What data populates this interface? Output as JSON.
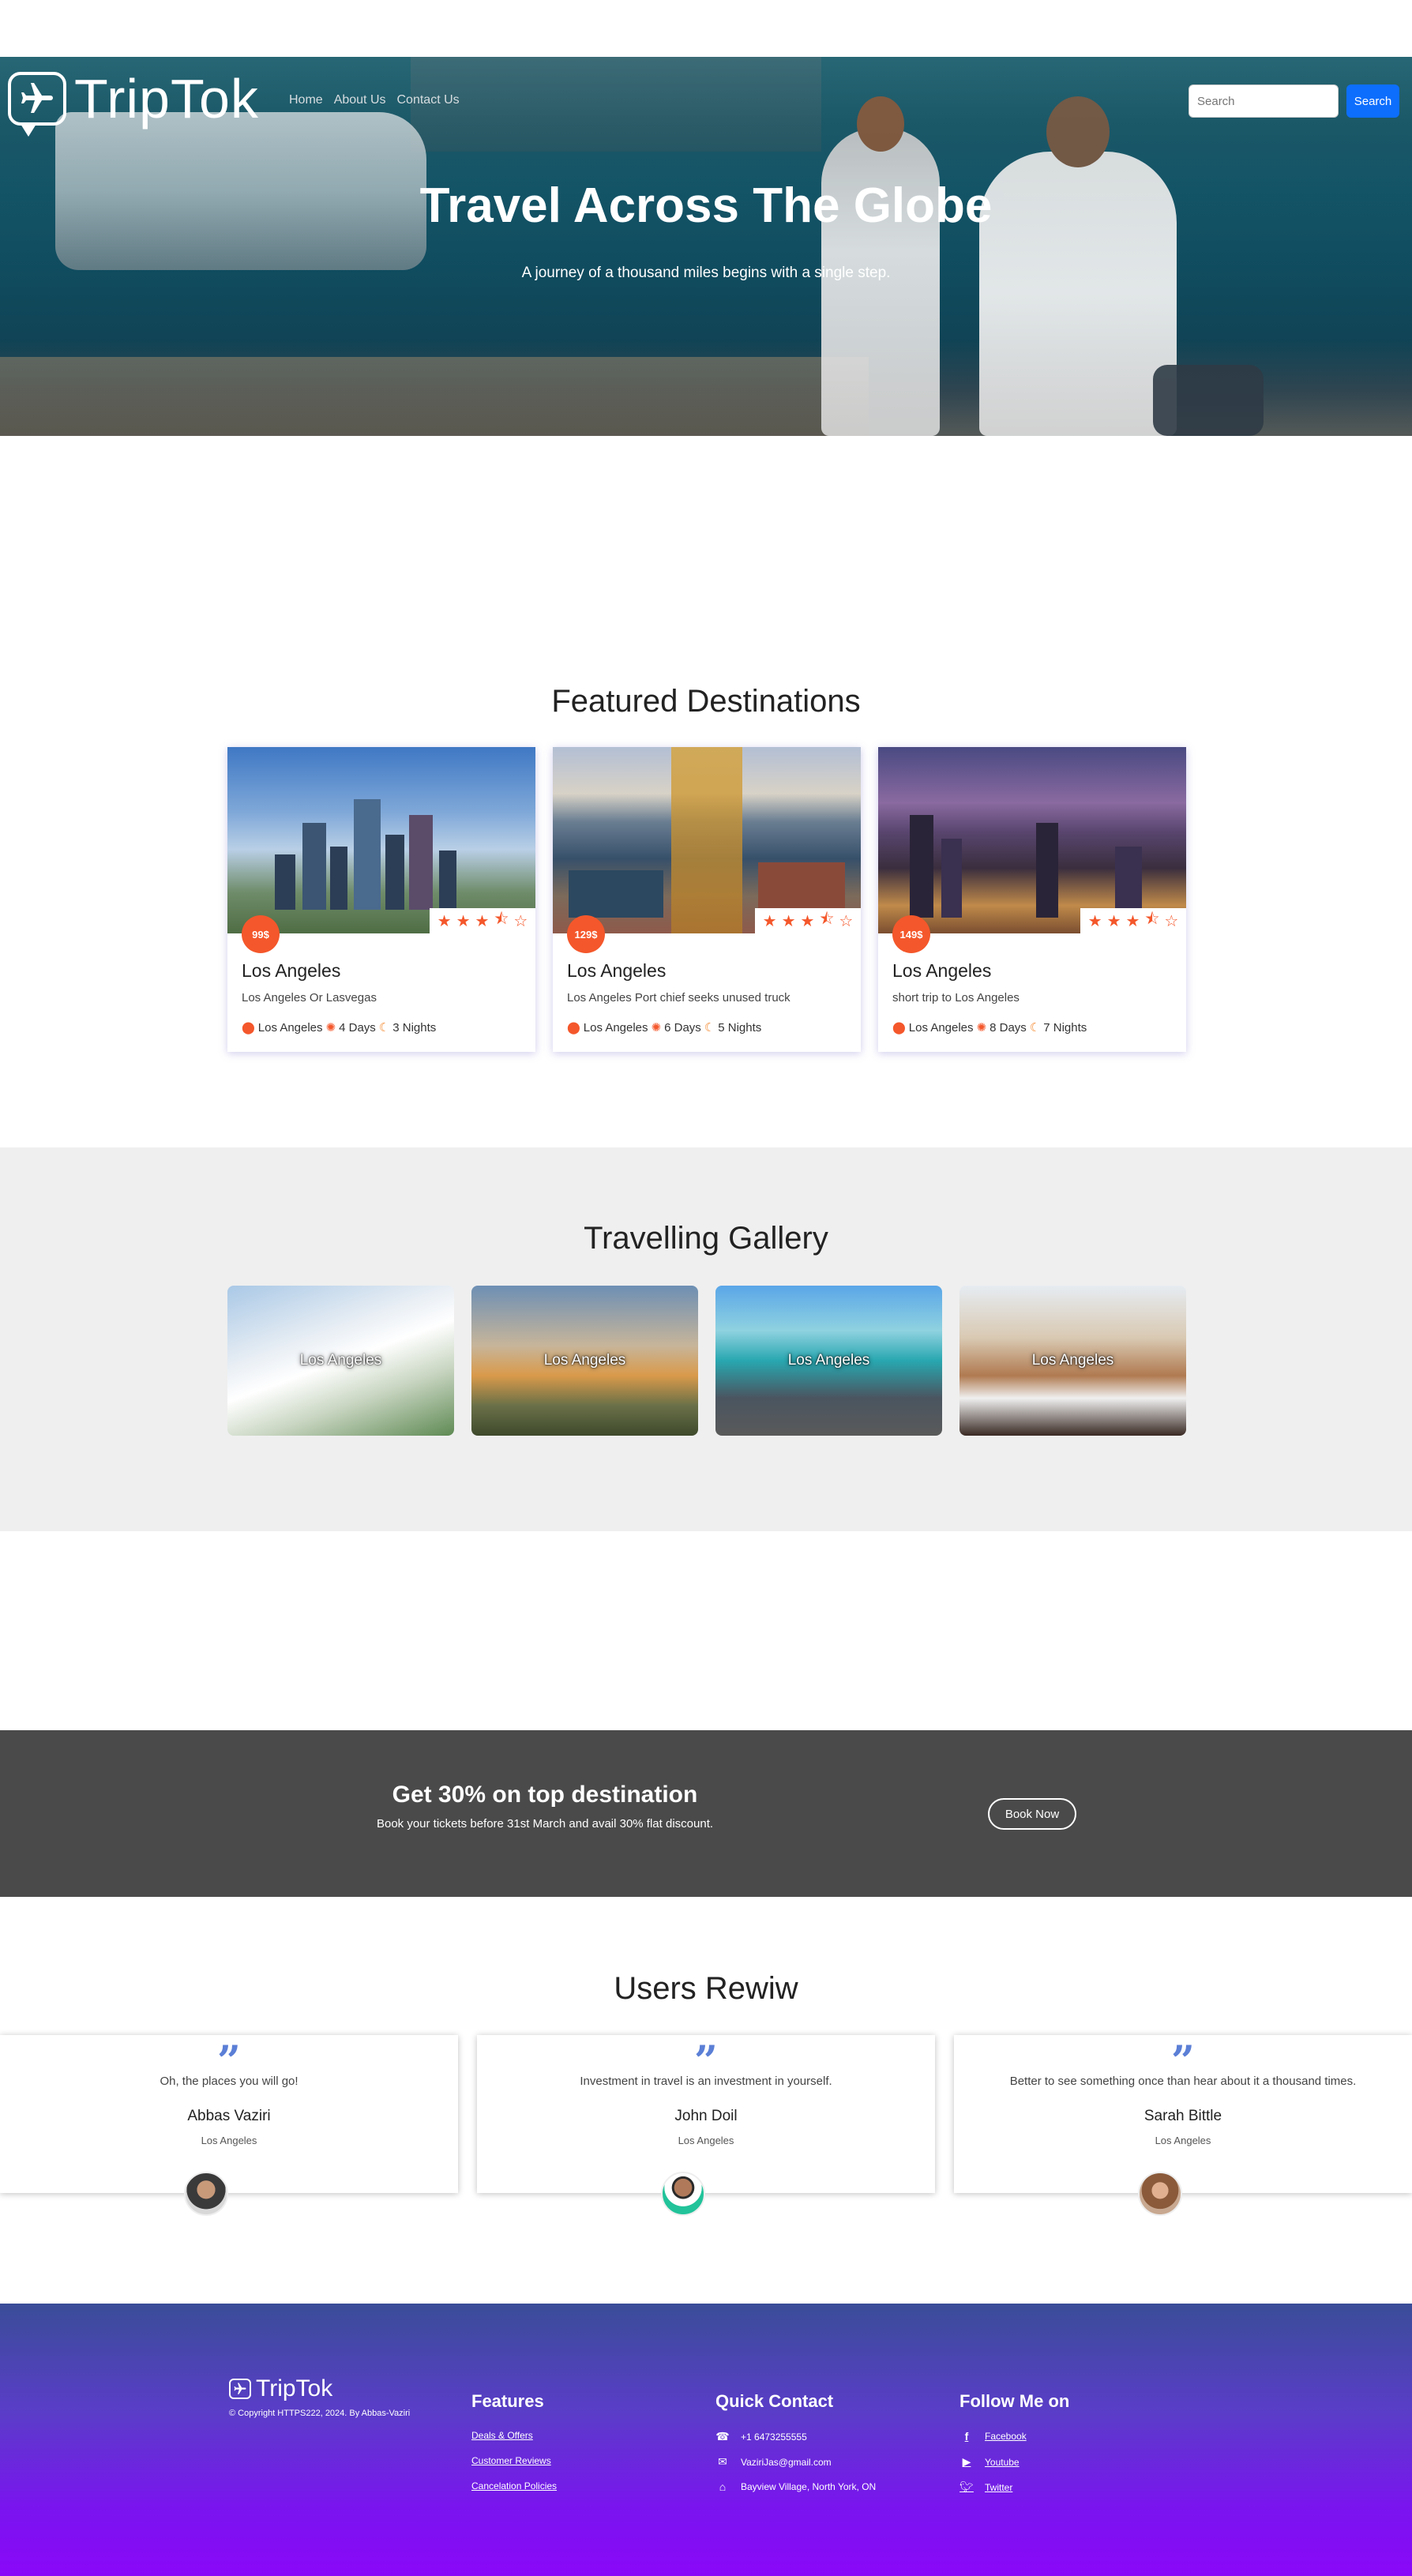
{
  "header": {
    "logo_text": "TripTok",
    "nav": [
      "Home",
      "About Us",
      "Contact Us"
    ],
    "search_placeholder": "Search",
    "search_button": "Search"
  },
  "hero": {
    "title": "Travel Across The Globe",
    "subtitle": "A journey of a thousand miles begins with a single step."
  },
  "featured": {
    "title": "Featured Destinations",
    "cards": [
      {
        "price": "99$",
        "rating": 3.5,
        "name": "Los Angeles",
        "description": "Los Angeles Or Lasvegas",
        "location": "Los Angeles",
        "days": "4 Days",
        "nights": "3 Nights"
      },
      {
        "price": "129$",
        "rating": 3.5,
        "name": "Los Angeles",
        "description": "Los Angeles Port chief seeks unused truck",
        "location": "Los Angeles",
        "days": "6 Days",
        "nights": "5 Nights"
      },
      {
        "price": "149$",
        "rating": 3.5,
        "name": "Los Angeles",
        "description": "short trip to Los Angeles",
        "location": "Los Angeles",
        "days": "8 Days",
        "nights": "7 Nights"
      }
    ]
  },
  "gallery": {
    "title": "Travelling Gallery",
    "items": [
      "Los Angeles",
      "Los Angeles",
      "Los Angeles",
      "Los Angeles"
    ]
  },
  "promo": {
    "title": "Get 30% on top destination",
    "subtitle": "Book your tickets before 31st March and avail 30% flat discount.",
    "button": "Book Now"
  },
  "reviews": {
    "title": "Users Rewiw",
    "items": [
      {
        "text": "Oh, the places you will go!",
        "name": "Abbas Vaziri",
        "location": "Los Angeles"
      },
      {
        "text": "Investment in travel is an investment in yourself.",
        "name": "John Doil",
        "location": "Los Angeles"
      },
      {
        "text": "Better to see something once than hear about it a thousand times.",
        "name": "Sarah Bittle",
        "location": "Los Angeles"
      }
    ]
  },
  "footer": {
    "logo_text": "TripTok",
    "copyright": "© Copyright HTTPS222, 2024. By Abbas-Vaziri",
    "features": {
      "title": "Features",
      "links": [
        "Deals & Offers",
        "Customer Reviews",
        "Cancelation Policies"
      ]
    },
    "contact": {
      "title": "Quick Contact",
      "phone": "+1 6473255555",
      "email": "VaziriJas@gmail.com",
      "address": "Bayview Village, North York, ON"
    },
    "social": {
      "title": "Follow Me on",
      "links": [
        "Facebook",
        "Youtube",
        "Twitter"
      ]
    }
  },
  "colors": {
    "accent": "#f4572b",
    "primary_button": "#0d6efd",
    "promo_bg": "#4a4a4a",
    "gallery_bg": "#efefef"
  },
  "icons": {
    "plane": "plane-icon",
    "pin": "map-pin-icon",
    "sun": "sun-icon",
    "moon": "moon-icon",
    "star": "star-icon",
    "quote": "quote-icon"
  }
}
